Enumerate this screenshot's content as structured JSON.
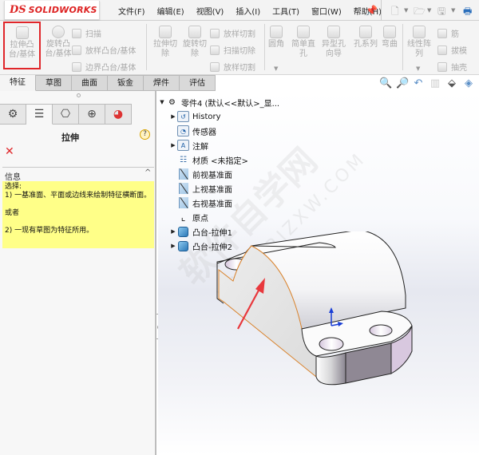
{
  "app": {
    "logo_prefix": "DS",
    "logo_text": "SOLIDWORKS"
  },
  "menu": [
    "文件(F)",
    "编辑(E)",
    "视图(V)",
    "插入(I)",
    "工具(T)",
    "窗口(W)",
    "帮助(H)"
  ],
  "quick_access": [
    "new-document-icon",
    "open-icon",
    "save-icon",
    "print-icon"
  ],
  "ribbon": {
    "extrude_boss": "拉伸凸\n台/基体",
    "revolve_boss": "旋转凸\n台/基体",
    "sweep": "扫描",
    "loft_boss": "放样凸台/基体",
    "boundary_boss": "边界凸台/基体",
    "extrude_cut": "拉伸切\n除",
    "revolve_cut": "旋转切\n除",
    "loft_cut_1": "放样切割",
    "sweep_cut": "扫描切除",
    "loft_cut_2": "放样切割",
    "fillet": "圆角",
    "simple_hole": "简单直\n孔",
    "hole_wizard": "异型孔\n向导",
    "hole_series": "孔系列",
    "flex": "弯曲",
    "linear_pattern": "线性阵\n列",
    "rib": "筋",
    "draft": "拔模",
    "shell": "抽壳"
  },
  "tabs": [
    {
      "label": "特征",
      "active": true
    },
    {
      "label": "草图",
      "active": false
    },
    {
      "label": "曲面",
      "active": false
    },
    {
      "label": "钣金",
      "active": false
    },
    {
      "label": "焊件",
      "active": false
    },
    {
      "label": "评估",
      "active": false
    }
  ],
  "view_tools": [
    "zoom-to-fit-icon",
    "zoom-to-area-icon",
    "previous-view-icon",
    "section-view-icon",
    "view-orientation-icon",
    "display-style-icon"
  ],
  "property_manager": {
    "tabs": [
      "feature-manager-icon",
      "property-manager-icon",
      "configuration-manager-icon",
      "dimxpert-icon",
      "display-manager-icon"
    ],
    "title": "拉伸",
    "help": "?",
    "cancel": "✕",
    "info_header": "信息",
    "info_lines": [
      "选择:",
      "1) 一基准面、平面或边线来绘制特征横断面。",
      "",
      "或者",
      "",
      "2) 一现有草图为特征所用。"
    ]
  },
  "feature_tree": {
    "root": "零件4  (默认<<默认>_显...",
    "items": [
      {
        "label": "History",
        "icon": "history-folder-icon",
        "expandable": true
      },
      {
        "label": "传感器",
        "icon": "sensors-folder-icon",
        "expandable": false
      },
      {
        "label": "注解",
        "icon": "annotations-folder-icon",
        "expandable": true
      },
      {
        "label": "材质 <未指定>",
        "icon": "material-icon",
        "expandable": false
      },
      {
        "label": "前视基准面",
        "icon": "plane-icon",
        "expandable": false
      },
      {
        "label": "上视基准面",
        "icon": "plane-icon",
        "expandable": false
      },
      {
        "label": "右视基准面",
        "icon": "plane-icon",
        "expandable": false
      },
      {
        "label": "原点",
        "icon": "origin-icon",
        "expandable": false
      },
      {
        "label": "凸台-拉伸1",
        "icon": "boss-extrude-icon",
        "expandable": true
      },
      {
        "label": "凸台-拉伸2",
        "icon": "boss-extrude-icon",
        "expandable": true
      }
    ]
  },
  "watermark": {
    "text": "软件自学网",
    "url_text": "WWW.RJZXW.COM"
  },
  "colors": {
    "accent_red": "#e0262a",
    "info_yellow": "#ffff88",
    "selection_orange": "#d9822b",
    "arrow_red": "#e8383d"
  }
}
